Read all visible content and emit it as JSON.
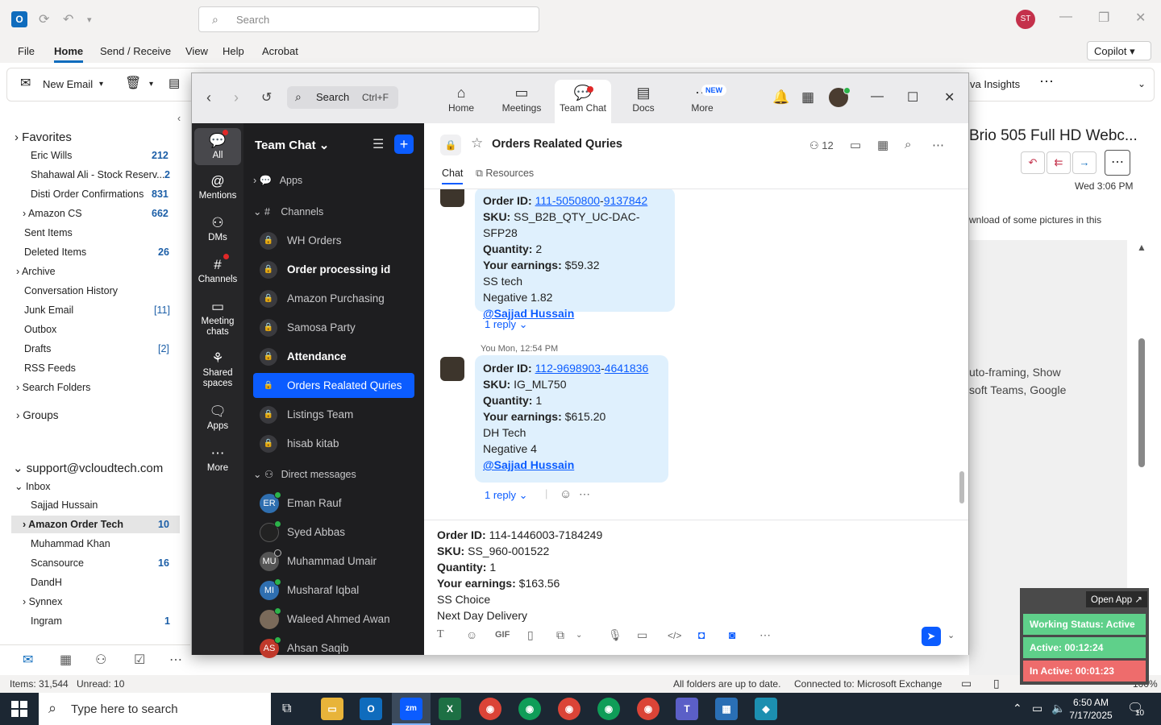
{
  "outlook": {
    "search_placeholder": "Search",
    "avatar": "ST",
    "menu": [
      "File",
      "Home",
      "Send / Receive",
      "View",
      "Help",
      "Acrobat"
    ],
    "copilot": "Copilot",
    "new_email": "New Email",
    "viva": "va Insights",
    "folders": [
      {
        "label": "Favorites",
        "count": ""
      },
      {
        "label": "Eric Wills",
        "count": "212"
      },
      {
        "label": "Shahawal Ali - Stock Reserv...",
        "count": "2"
      },
      {
        "label": "Disti Order Confirmations",
        "count": "831"
      },
      {
        "label": "Amazon CS",
        "count": "662"
      },
      {
        "label": "Sent Items",
        "count": ""
      },
      {
        "label": "Deleted Items",
        "count": "26"
      },
      {
        "label": "Archive",
        "count": ""
      },
      {
        "label": "Conversation History",
        "count": ""
      },
      {
        "label": "Junk Email",
        "count": "[11]"
      },
      {
        "label": "Outbox",
        "count": ""
      },
      {
        "label": "Drafts",
        "count": "[2]"
      },
      {
        "label": "RSS Feeds",
        "count": ""
      },
      {
        "label": "Search Folders",
        "count": ""
      },
      {
        "label": "Groups",
        "count": ""
      },
      {
        "label": "support@vcloudtech.com",
        "count": ""
      },
      {
        "label": "Inbox",
        "count": ""
      },
      {
        "label": "Sajjad Hussain",
        "count": ""
      },
      {
        "label": "Amazon Order Tech",
        "count": "10"
      },
      {
        "label": "Muhammad Khan",
        "count": ""
      },
      {
        "label": "Scansource",
        "count": "16"
      },
      {
        "label": "DandH",
        "count": ""
      },
      {
        "label": "Synnex",
        "count": ""
      },
      {
        "label": "Ingram",
        "count": "1"
      }
    ],
    "reading": {
      "subject": "Brio 505 Full HD Webc...",
      "date": "Wed 3:06 PM",
      "notice": "wnload of some pictures in this",
      "body1": "uto-framing, Show",
      "body2": "soft Teams, Google"
    },
    "status": {
      "items": "Items: 31,544",
      "unread": "Unread: 10",
      "sync": "All folders are up to date.",
      "connected": "Connected to: Microsoft Exchange",
      "zoom_pct": "100%"
    }
  },
  "zoom": {
    "search": "Search",
    "search_kbd": "Ctrl+F",
    "tabs": [
      "Home",
      "Meetings",
      "Team Chat",
      "Docs",
      "More"
    ],
    "new_badge": "NEW",
    "rail": [
      "All",
      "Mentions",
      "DMs",
      "Channels",
      "Meeting chats",
      "Shared spaces",
      "Apps",
      "More"
    ],
    "sidebar": {
      "title": "Team Chat",
      "apps": "Apps",
      "channels_label": "Channels",
      "channels": [
        {
          "name": "WH Orders",
          "bold": false
        },
        {
          "name": "Order processing id",
          "bold": true
        },
        {
          "name": "Amazon Purchasing",
          "bold": false
        },
        {
          "name": "Samosa Party",
          "bold": false
        },
        {
          "name": "Attendance",
          "bold": true
        },
        {
          "name": "Orders Realated Quries",
          "bold": false
        },
        {
          "name": "Listings Team",
          "bold": false
        },
        {
          "name": "hisab kitab",
          "bold": false
        }
      ],
      "dm_label": "Direct messages",
      "dms": [
        {
          "name": "Eman Rauf",
          "initials": "ER",
          "color": "#2f6fb0"
        },
        {
          "name": "Syed Abbas",
          "initials": "",
          "color": "#222"
        },
        {
          "name": "Muhammad Umair",
          "initials": "MU",
          "color": "#555"
        },
        {
          "name": "Musharaf Iqbal",
          "initials": "MI",
          "color": "#2f6fb0"
        },
        {
          "name": "Waleed Ahmed Awan",
          "initials": "",
          "color": "#7a6a5a"
        },
        {
          "name": "Ahsan Saqib",
          "initials": "AS",
          "color": "#c0392b"
        }
      ]
    },
    "chat": {
      "title": "Orders Realated Quries",
      "member_count": "12",
      "tab_chat": "Chat",
      "tab_resources": "Resources",
      "messages": [
        {
          "order_label": "Order ID:",
          "order_a": "111-5050800",
          "order_b": "9137842",
          "sku_label": "SKU:",
          "sku": "SS_B2B_QTY_UC-DAC-SFP28",
          "qty_label": "Quantity:",
          "qty": "2",
          "earn_label": "Your earnings:",
          "earn": "$59.32",
          "line5": "SS tech",
          "line6": "Negative 1.82",
          "mention": "@Sajjad Hussain",
          "reply": "1 reply"
        },
        {
          "meta": "You Mon, 12:54 PM",
          "order_label": "Order ID:",
          "order_a": "112-9698903",
          "order_b": "4641836",
          "sku_label": "SKU:",
          "sku": "IG_ML750",
          "qty_label": "Quantity:",
          "qty": "1",
          "earn_label": "Your earnings:",
          "earn": "$615.20",
          "line5": "DH Tech",
          "line6": "Negative 4",
          "mention": "@Sajjad Hussain",
          "reply": "1 reply"
        }
      ],
      "compose": {
        "order_label": "Order ID:",
        "order": "114-1446003-7184249",
        "sku_label": "SKU:",
        "sku": "SS_960-001522",
        "qty_label": "Quantity:",
        "qty": "1",
        "earn_label": "Your earnings:",
        "earn": "$163.56",
        "line5": "SS Choice",
        "line6": "Next Day Delivery"
      }
    }
  },
  "widget": {
    "open_app": "Open App ↗",
    "working": "Working Status: Active",
    "active": "Active: 00:12:24",
    "inactive": "In Active: 00:01:23"
  },
  "taskbar": {
    "search": "Type here to search",
    "time": "6:50 AM",
    "date": "7/17/2025",
    "notif": "10"
  }
}
